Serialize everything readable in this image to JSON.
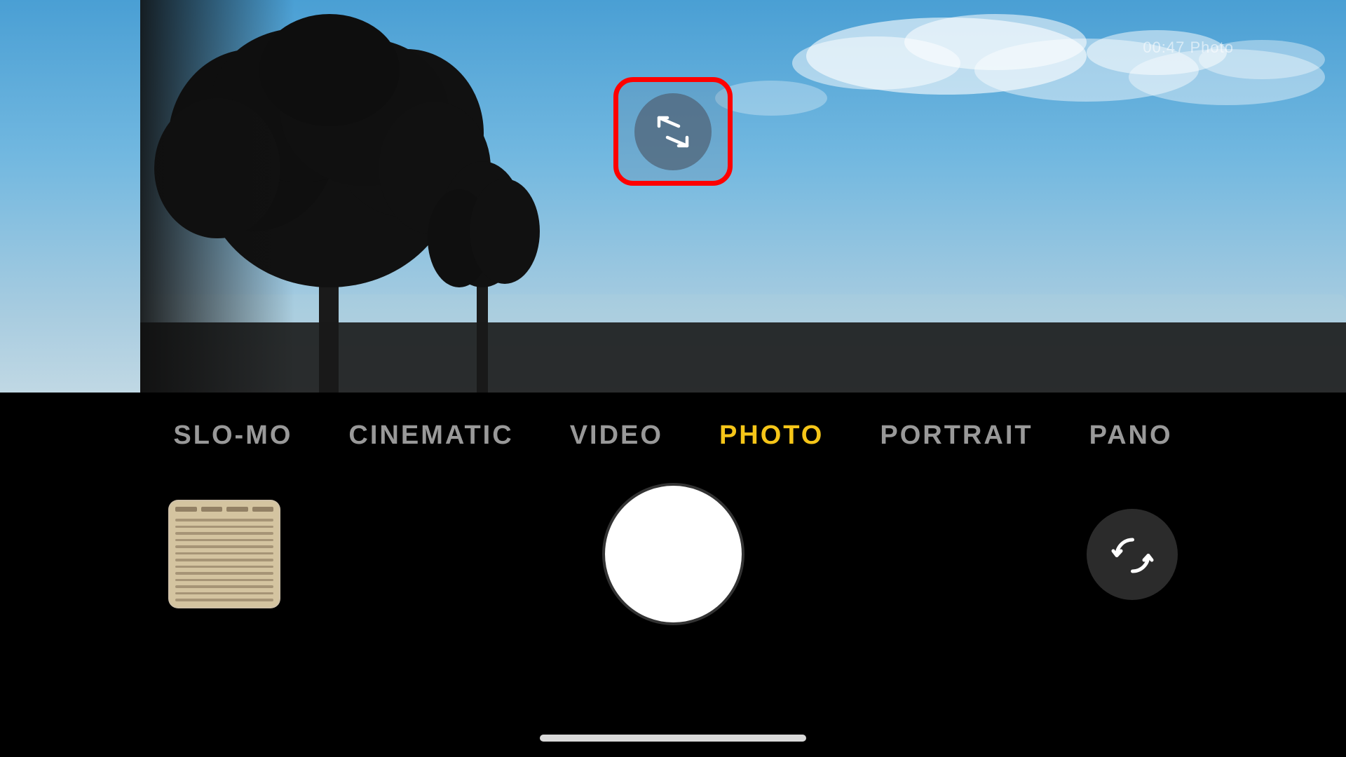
{
  "viewfinder": {
    "alt": "Sky and tree silhouette camera viewfinder"
  },
  "top_right_info": {
    "text": "00:47 Photo"
  },
  "resize_button": {
    "label": "Resize/Expand",
    "aria": "resize-expand-icon"
  },
  "red_highlight": {
    "color": "#ff0000"
  },
  "modes": [
    {
      "id": "slo-mo",
      "label": "SLO-MO",
      "active": false
    },
    {
      "id": "cinematic",
      "label": "CINEMATIC",
      "active": false
    },
    {
      "id": "video",
      "label": "VIDEO",
      "active": false
    },
    {
      "id": "photo",
      "label": "PHOTO",
      "active": true
    },
    {
      "id": "portrait",
      "label": "PORTRAIT",
      "active": false
    },
    {
      "id": "pano",
      "label": "PANO",
      "active": false
    }
  ],
  "active_mode_color": "#f5c518",
  "shutter": {
    "label": "Take Photo"
  },
  "gallery": {
    "label": "Gallery thumbnail"
  },
  "flip": {
    "label": "Flip Camera"
  },
  "home_indicator": {
    "label": "Home indicator"
  }
}
